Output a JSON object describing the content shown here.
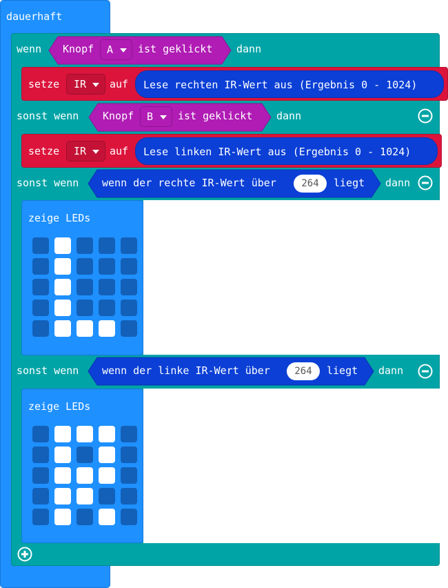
{
  "forever": {
    "label": "dauerhaft"
  },
  "if_block": {
    "wenn": "wenn",
    "dann": "dann",
    "sonst_wenn": "sonst wenn",
    "condition_a": {
      "prefix": "Knopf",
      "button": "A",
      "suffix": "ist geklickt"
    },
    "condition_b": {
      "prefix": "Knopf",
      "button": "B",
      "suffix": "ist geklickt"
    },
    "set1": {
      "label": "setze",
      "variable": "IR",
      "auf": "auf",
      "value": "Lese rechten IR-Wert aus (Ergebnis 0 - 1024)"
    },
    "set2": {
      "label": "setze",
      "variable": "IR",
      "auf": "auf",
      "value": "Lese linken IR-Wert aus (Ergebnis 0 - 1024)"
    },
    "condition_c": {
      "prefix": "wenn der rechte IR-Wert über",
      "threshold": "264",
      "suffix": "liegt"
    },
    "condition_d": {
      "prefix": "wenn der linke IR-Wert über",
      "threshold": "264",
      "suffix": "liegt"
    }
  },
  "show_leds_1": {
    "label": "zeige LEDs",
    "grid": [
      [
        0,
        1,
        0,
        0,
        0
      ],
      [
        0,
        1,
        0,
        0,
        0
      ],
      [
        0,
        1,
        0,
        0,
        0
      ],
      [
        0,
        1,
        0,
        0,
        0
      ],
      [
        0,
        1,
        1,
        1,
        0
      ]
    ]
  },
  "show_leds_2": {
    "label": "zeige LEDs",
    "grid": [
      [
        0,
        1,
        1,
        1,
        0
      ],
      [
        0,
        1,
        0,
        1,
        0
      ],
      [
        0,
        1,
        1,
        1,
        0
      ],
      [
        0,
        1,
        1,
        0,
        0
      ],
      [
        0,
        1,
        0,
        1,
        0
      ]
    ]
  },
  "colors": {
    "forever": "#1e90ff",
    "if": "#00a4a6",
    "set": "#dc143c",
    "input": "#b01cb4",
    "reporter": "#0b3fd6"
  },
  "icons": {
    "remove_branch": "minus-circle-icon",
    "add_branch": "plus-circle-icon",
    "dropdown": "caret-down-icon"
  }
}
